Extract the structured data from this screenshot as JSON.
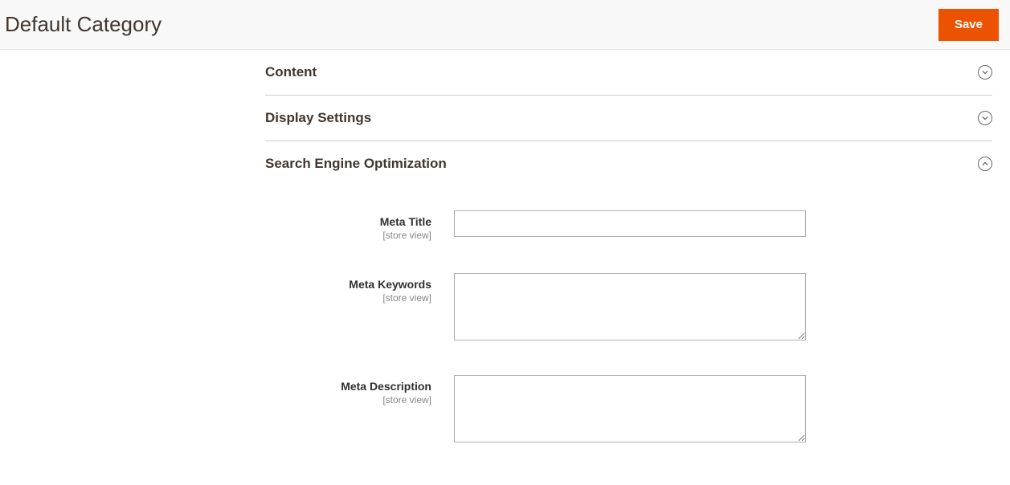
{
  "header": {
    "title": "Default Category",
    "save_label": "Save"
  },
  "sections": {
    "content": {
      "title": "Content",
      "expanded": false
    },
    "display_settings": {
      "title": "Display Settings",
      "expanded": false
    },
    "seo": {
      "title": "Search Engine Optimization",
      "expanded": true,
      "fields": {
        "meta_title": {
          "label": "Meta Title",
          "scope": "[store view]",
          "value": ""
        },
        "meta_keywords": {
          "label": "Meta Keywords",
          "scope": "[store view]",
          "value": ""
        },
        "meta_description": {
          "label": "Meta Description",
          "scope": "[store view]",
          "value": ""
        }
      }
    }
  }
}
